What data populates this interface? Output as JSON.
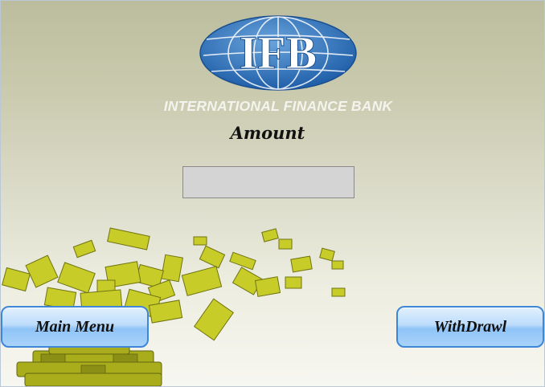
{
  "brand": {
    "logo_text": "IFB",
    "bank_name": "INTERNATIONAL FINANCE BANK",
    "logo_color": "#2f6fb3"
  },
  "form": {
    "amount_label": "Amount",
    "amount_value": "",
    "amount_placeholder": ""
  },
  "buttons": {
    "main_menu": "Main Menu",
    "withdraw": "WithDrawl"
  },
  "decoration": {
    "illustration": "flying-money-icon"
  }
}
